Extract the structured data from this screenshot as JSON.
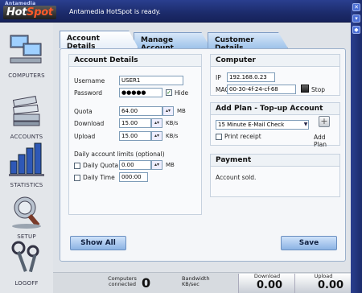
{
  "app": {
    "logo_small": "Antamedia",
    "logo_main_a": "Hot",
    "logo_main_b": "Spot",
    "status": "Antamedia HotSpot is ready."
  },
  "nav": [
    {
      "label": "COMPUTERS",
      "icon": "computers-icon"
    },
    {
      "label": "ACCOUNTS",
      "icon": "accounts-icon"
    },
    {
      "label": "STATISTICS",
      "icon": "statistics-icon"
    },
    {
      "label": "SETUP",
      "icon": "setup-icon"
    },
    {
      "label": "LOGOFF",
      "icon": "logoff-icon"
    }
  ],
  "tabs": [
    "Account Details",
    "Manage Account",
    "Customer Details"
  ],
  "account": {
    "header": "Account Details",
    "username_label": "Username",
    "username": "USER1",
    "password_label": "Password",
    "password": "●●●●●",
    "hide_label": "Hide",
    "quota_label": "Quota",
    "quota": "64.00",
    "quota_unit": "MB",
    "download_label": "Download",
    "download": "15.00",
    "download_unit": "KB/s",
    "upload_label": "Upload",
    "upload": "15.00",
    "upload_unit": "KB/s",
    "daily_limits_label": "Daily account limits (optional)",
    "daily_quota_label": "Daily Quota",
    "daily_quota": "0.00",
    "daily_quota_unit": "MB",
    "daily_time_label": "Daily Time",
    "daily_time": "000:00"
  },
  "computer": {
    "header": "Computer",
    "ip_label": "IP",
    "ip": "192.168.0.23",
    "mac_label": "MAC",
    "mac": "00-30-4f-24-cf-68",
    "stop_label": "Stop"
  },
  "plan": {
    "header": "Add Plan -  Top-up Account",
    "selected": "15 Minute E-Mail Check",
    "print_receipt_label": "Print receipt",
    "add_plan_label": "Add Plan"
  },
  "payment": {
    "header": "Payment",
    "text": "Account sold."
  },
  "buttons": {
    "show_all": "Show All",
    "save": "Save"
  },
  "statusbar": {
    "computers_label": "Computers connected",
    "computers_value": "0",
    "bandwidth_label": "Bandwidth KB/sec",
    "download_label": "Download",
    "download_value": "0.00",
    "upload_label": "Upload",
    "upload_value": "0.00"
  }
}
